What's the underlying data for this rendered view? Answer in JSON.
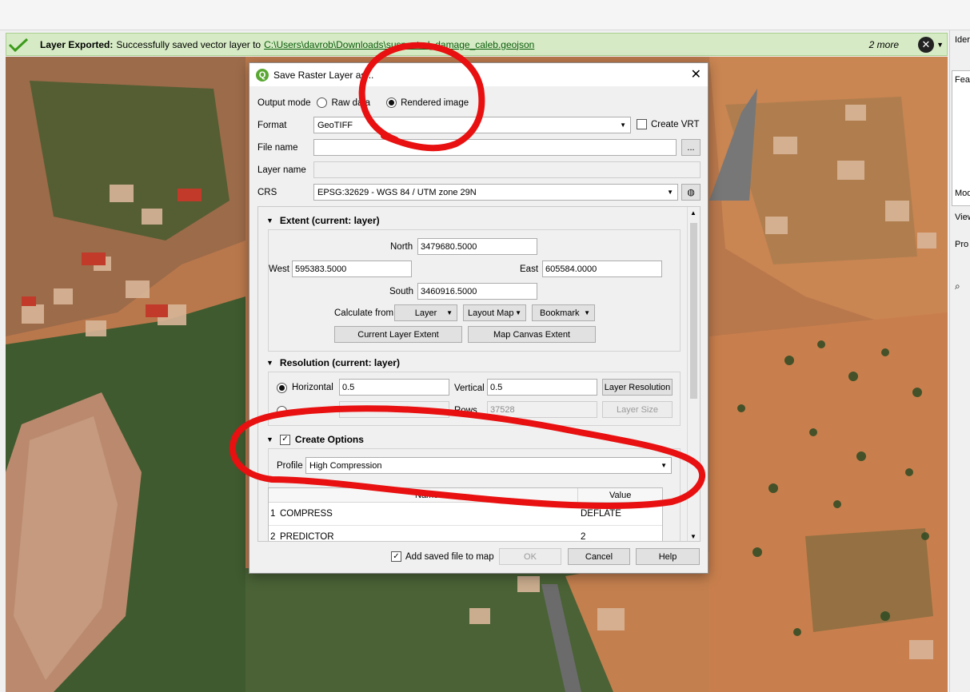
{
  "message_bar": {
    "title": "Layer Exported:",
    "text": "Successfully saved vector layer to",
    "link": "C:\\Users\\davrob\\Downloads\\suspected_damage_caleb.geojson",
    "more": "2 more"
  },
  "right_panel": {
    "labels": [
      "Ider",
      "Feat",
      "Mod",
      "View",
      "Pro"
    ]
  },
  "dialog": {
    "title": "Save Raster Layer as...",
    "output_mode_label": "Output mode",
    "raw_data_label": "Raw data",
    "rendered_image_label": "Rendered image",
    "format_label": "Format",
    "format_value": "GeoTIFF",
    "create_vrt_label": "Create VRT",
    "file_name_label": "File name",
    "file_name_value": "",
    "browse_label": "...",
    "layer_name_label": "Layer name",
    "crs_label": "CRS",
    "crs_value": "EPSG:32629 - WGS 84 / UTM zone 29N",
    "extent": {
      "header": "Extent (current: layer)",
      "north_label": "North",
      "north": "3479680.5000",
      "west_label": "West",
      "west": "595383.5000",
      "east_label": "East",
      "east": "605584.0000",
      "south_label": "South",
      "south": "3460916.5000",
      "calculate_from_label": "Calculate from",
      "layer_btn": "Layer",
      "layout_map_btn": "Layout Map",
      "bookmark_btn": "Bookmark",
      "current_layer_extent_btn": "Current Layer Extent",
      "map_canvas_extent_btn": "Map Canvas Extent"
    },
    "resolution": {
      "header": "Resolution (current: layer)",
      "horizontal_label": "Horizontal",
      "horizontal": "0.5",
      "vertical_label": "Vertical",
      "vertical": "0.5",
      "layer_resolution_btn": "Layer Resolution",
      "rows_label": "Rows",
      "rows": "37528",
      "layer_size_btn": "Layer Size"
    },
    "create_options": {
      "header": "Create Options",
      "profile_label": "Profile",
      "profile_value": "High Compression",
      "col_name": "Name",
      "col_value": "Value",
      "rows": [
        {
          "idx": "1",
          "name": "COMPRESS",
          "value": "DEFLATE"
        },
        {
          "idx": "2",
          "name": "PREDICTOR",
          "value": "2"
        }
      ]
    },
    "add_saved_file_label": "Add saved file to map",
    "ok_btn": "OK",
    "cancel_btn": "Cancel",
    "help_btn": "Help"
  },
  "colors": {
    "message_bar_bg": "#d6ebc5",
    "annotation_red": "#e81010",
    "qgis_green": "#5aa832"
  }
}
